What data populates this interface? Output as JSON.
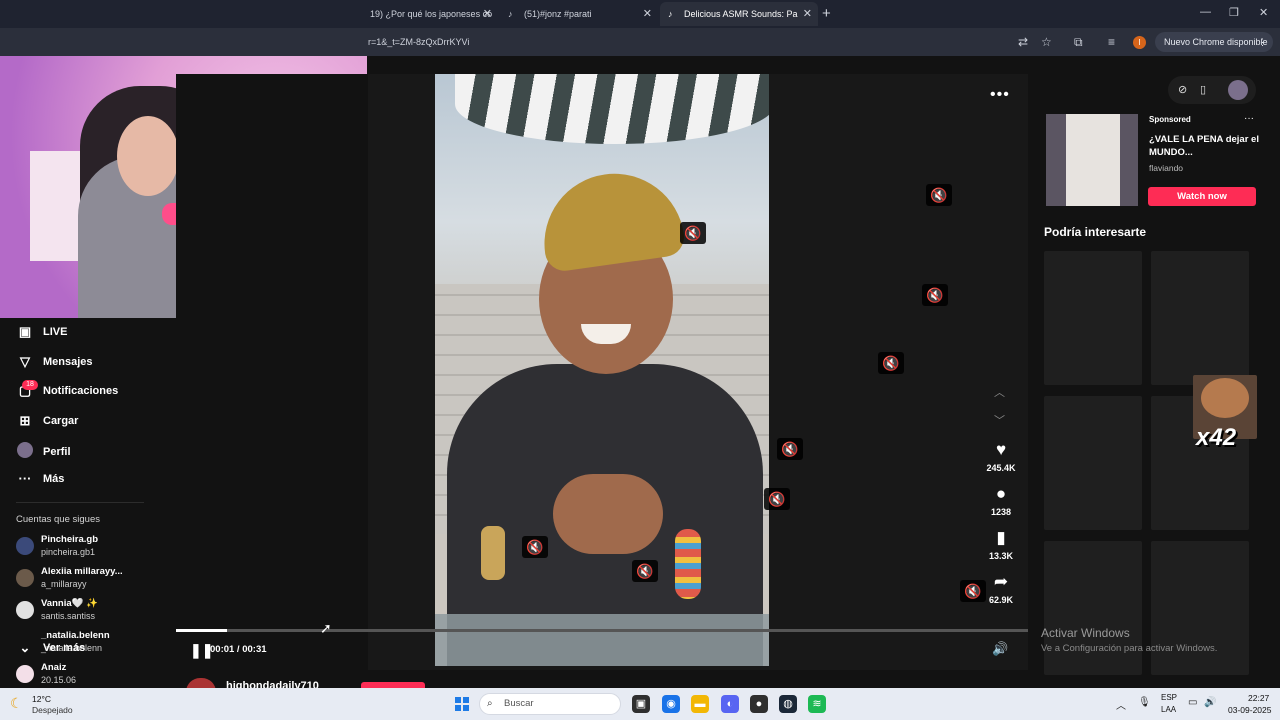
{
  "browser": {
    "tabs": [
      {
        "label": "19) ¿Por qué los japoneses co",
        "active": false
      },
      {
        "label": "(51)#jonz #parati",
        "active": false
      },
      {
        "label": "Delicious ASMR Sounds: Pa",
        "active": true
      }
    ],
    "address": "r=1&_t=ZM-8zQxDrrKYVi",
    "profile_initial": "I",
    "update_label": "Nuevo Chrome disponible"
  },
  "sidebar": {
    "items": [
      {
        "label": "LIVE",
        "icon": "live-icon"
      },
      {
        "label": "Mensajes",
        "icon": "send-icon"
      },
      {
        "label": "Notificaciones",
        "icon": "inbox-icon",
        "badge": "18"
      },
      {
        "label": "Cargar",
        "icon": "upload-icon"
      },
      {
        "label": "Perfil",
        "icon": "avatar"
      },
      {
        "label": "Más",
        "icon": "more-icon"
      }
    ],
    "following_title": "Cuentas que sigues",
    "following": [
      {
        "name": "Pincheira.gb",
        "handle": "pincheira.gb1",
        "color": "#3b4a7a"
      },
      {
        "name": "Alexiia millarayy...",
        "handle": "a_millarayy",
        "color": "#6b5a4a"
      },
      {
        "name": "Vannia🤍 ✨",
        "handle": "santis.santiss",
        "color": "#e0e0e0"
      },
      {
        "name": "_natalia.belenn",
        "handle": "_natalia.belenn",
        "color": "#121212"
      },
      {
        "name": "Anaiz",
        "handle": "20.15.06",
        "color": "#f3dfe8"
      }
    ],
    "see_more": "Ver más"
  },
  "player": {
    "time": "00:01 / 00:31",
    "progress": 0.06,
    "likes": "245.4K",
    "comments": "1238",
    "saves": "13.3K",
    "shares": "62.9K",
    "below_username": "highondadaily710"
  },
  "right": {
    "ad": {
      "sponsored": "Sponsored",
      "title": "¿VALE LA PENA dejar el MUNDO...",
      "brand": "flaviando",
      "cta": "Watch now"
    },
    "suggest_title": "Podría interesarte",
    "overlay_text": "x42",
    "activate_title": "Activar Windows",
    "activate_sub": "Ve a Configuración para activar Windows."
  },
  "taskbar": {
    "temp": "12°C",
    "weather": "Despejado",
    "search_placeholder": "Buscar",
    "lang1": "ESP",
    "lang2": "LAA",
    "time": "22:27",
    "date": "03-09-2025"
  },
  "colors": {
    "accent": "#fe2c55",
    "background": "#121212"
  }
}
